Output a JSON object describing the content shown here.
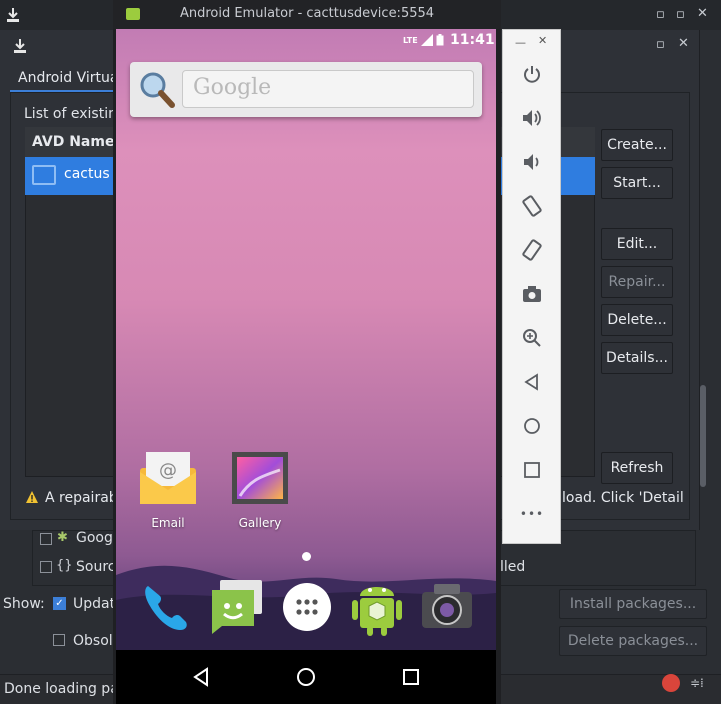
{
  "sdk_window": {
    "avd_tab_label": "Android Virtua",
    "list_label": "List of existing",
    "table_header": "AVD Name",
    "avd_row_label": "cactus",
    "buttons": {
      "create": "Create...",
      "start": "Start...",
      "edit": "Edit...",
      "repair": "Repair...",
      "delete": "Delete...",
      "details": "Details...",
      "refresh": "Refresh"
    },
    "warning_left": "A repairab",
    "warning_right": "load. Click 'Detail"
  },
  "packages": {
    "row1_label": "Goog",
    "row2_label": "Sourc",
    "row2_right": "lled",
    "show_label": "Show:",
    "updates_label": "Updat",
    "obsolete_label": "Obsol",
    "install_button": "Install packages...",
    "delete_button": "Delete packages..."
  },
  "status": {
    "text": "Done loading pac"
  },
  "emulator": {
    "title": "Android Emulator - cacttusdevice:5554",
    "status_network": "LTE",
    "clock": "11:41",
    "search_placeholder": "Google",
    "apps": [
      {
        "label": "Email"
      },
      {
        "label": "Gallery"
      }
    ],
    "controls": {
      "more": "•••"
    }
  }
}
